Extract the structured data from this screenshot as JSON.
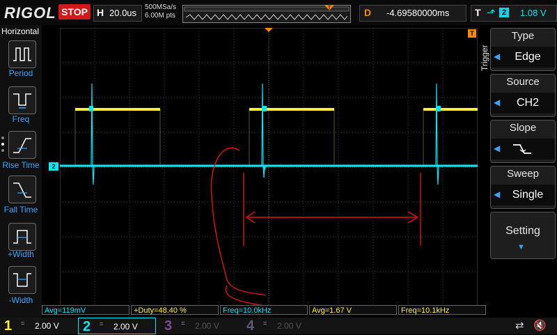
{
  "header": {
    "brand": "RIGOL",
    "run_state": "STOP",
    "timebase_label": "H",
    "timebase_value": "20.0us",
    "sample_rate": "500MSa/s",
    "memory_depth": "6.00M pts",
    "trigger_position_marker": "T",
    "delay_label": "D",
    "delay_value": "-4.69580000ms",
    "trigger_label": "T",
    "trigger_slope_icon": "rising-edge-icon",
    "trigger_source": "2",
    "trigger_level": "1.08 V"
  },
  "left_menu": {
    "title": "Horizontal",
    "items": [
      {
        "label": "Period",
        "icon": "period-icon"
      },
      {
        "label": "Freq",
        "icon": "frequency-icon"
      },
      {
        "label": "Rise Time",
        "icon": "rise-time-icon"
      },
      {
        "label": "Fall Time",
        "icon": "fall-time-icon"
      },
      {
        "label": "+Width",
        "icon": "positive-width-icon"
      },
      {
        "label": "-Width",
        "icon": "negative-width-icon"
      }
    ]
  },
  "right_menu": {
    "title": "Trigger",
    "items": [
      {
        "title": "Type",
        "value": "Edge"
      },
      {
        "title": "Source",
        "value": "CH2"
      },
      {
        "title": "Slope",
        "value": "falling-edge-icon"
      },
      {
        "title": "Sweep",
        "value": "Single"
      },
      {
        "title": "Setting",
        "value": "chevron-down-icon"
      }
    ]
  },
  "markers": {
    "ch2_ground": "2",
    "trigger_level": "T",
    "trigger_top": "T"
  },
  "measurements": [
    {
      "text": "Avg=119mV",
      "color": "#00e0ff"
    },
    {
      "text": "+Duty=48.40 %",
      "color": "#ffef3a"
    },
    {
      "text": "Freq=10.0kHz",
      "color": "#00e0ff"
    },
    {
      "text": "Avg=1.67 V",
      "color": "#ffef3a"
    },
    {
      "text": "Freq=10.1kHz",
      "color": "#ffef3a"
    }
  ],
  "channels": [
    {
      "num": "1",
      "coupling": "=",
      "scale": "2.00 V",
      "color": "#ffef3a",
      "active": true
    },
    {
      "num": "2",
      "coupling": "=",
      "scale": "2.00 V",
      "color": "#00e8f8",
      "active": true
    },
    {
      "num": "3",
      "coupling": "=",
      "scale": "2.00 V",
      "color": "#7a4a8a",
      "active": false
    },
    {
      "num": "4",
      "coupling": "=",
      "scale": "2.00 V",
      "color": "#5a5a7a",
      "active": false
    }
  ],
  "status_icons": [
    "usb-icon",
    "speaker-mute-icon"
  ],
  "colors": {
    "ch1": "#ffef3a",
    "ch2": "#00e8f8",
    "trigger": "#ff8a00",
    "stop": "#d01818",
    "annotation": "#e01010"
  }
}
